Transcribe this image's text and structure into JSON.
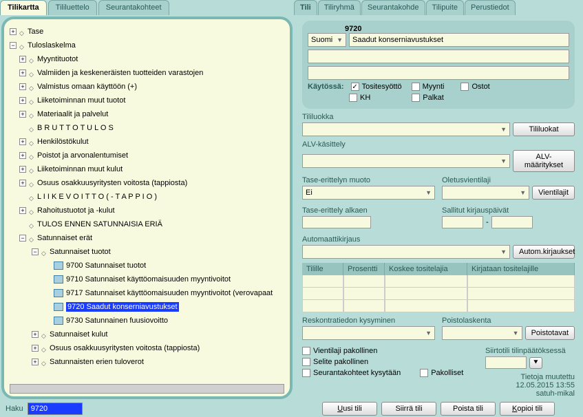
{
  "left_tabs": {
    "t1": "Tilikartta",
    "t2": "Tililuettelo",
    "t3": "Seurantakohteet"
  },
  "right_tabs": {
    "t1": "Tili",
    "t2": "Tiliryhmä",
    "t3": "Seurantakohde",
    "t4": "Tilipuite",
    "t5": "Perustiedot"
  },
  "tree": {
    "tase": "Tase",
    "tulos": "Tuloslaskelma",
    "myyntituotot": "Myyntituotot",
    "valmiiden": "Valmiiden ja keskeneräisten tuotteiden varastojen",
    "valmistus": "Valmistus omaan käyttöön (+)",
    "liiketoim_tuotot": "Liiketoiminnan muut tuotot",
    "materiaalit": "Materiaalit ja palvelut",
    "bruttotulos": "B R U T T O T U L O S",
    "henkilosto": "Henkilöstökulut",
    "poistot": "Poistot ja arvonalentumiset",
    "liiketoim_kulut": "Liiketoiminnan muut kulut",
    "osuus_voitosta": "Osuus osakkuusyritysten voitosta (tappiosta)",
    "liikevoitto": "L I I K E V O I T T O  ( - T A P P I O )",
    "rahoitus": "Rahoitustuotot ja -kulut",
    "tulos_ennen": "TULOS ENNEN SATUNNAISIA ERIÄ",
    "satunnaiset": "Satunnaiset erät",
    "sat_tuotot": "Satunnaiset tuotot",
    "a9700": "9700 Satunnaiset tuotot",
    "a9710": "9710 Satunnaiset käyttöomaisuuden myyntivoitot",
    "a9717": "9717 Satunnaiset käyttöomaisuuden myyntivoitot (verovapaat",
    "a9720": "9720 Saadut konserniavustukset",
    "a9730": "9730 Satunnainen fuusiovoitto",
    "sat_kulut": "Satunnaiset kulut",
    "osuus_voitosta2": "Osuus osakkuusyritysten voitosta (tappiosta)",
    "sat_tuloverot": "Satunnaisten erien tuloverot"
  },
  "search": {
    "label": "Haku",
    "value": "9720"
  },
  "account": {
    "number": "9720",
    "lang": "Suomi",
    "name": "Saadut konserniavustukset",
    "kaytossa_label": "Käytössä:",
    "chk_tosite": "Tositesyöttö",
    "chk_myynti": "Myynti",
    "chk_ostot": "Ostot",
    "chk_kh": "KH",
    "chk_palkat": "Palkat",
    "tililuokka_label": "Tililuokka",
    "btn_tililuokat": "Tililuokat",
    "alv_label": "ALV-käsittely",
    "btn_alv": "ALV-määritykset",
    "tase_erittely_label": "Tase-erittelyn muoto",
    "tase_erittely_val": "Ei",
    "oletusvienti_label": "Oletusvientilaji",
    "btn_vientilajit": "Vientilajit",
    "tase_alkaen_label": "Tase-erittely alkaen",
    "sallitut_label": "Sallitut kirjauspäivät",
    "autokirjaus_label": "Automaattikirjaus",
    "btn_autokirjaus": "Autom.kirjaukset",
    "grid_tilille": "Tilille",
    "grid_prosentti": "Prosentti",
    "grid_koskee": "Koskee tositelajia",
    "grid_kirjataan": "Kirjataan tositelajille",
    "reskontra_label": "Reskontratiedon kysyminen",
    "poistolask_label": "Poistolaskenta",
    "btn_poistotavat": "Poistotavat",
    "vientilaji_pak": "Vientilaji pakollinen",
    "siirtotili_label": "Siirtotili tilinpäätöksessä",
    "selite_pak": "Selite pakollinen",
    "seuranta_kys": "Seurantakohteet kysytään",
    "pakolliset": "Pakolliset",
    "meta1": "Tietoja muutettu",
    "meta2": "12.05.2015 13:55",
    "meta3": "satuh-mikal",
    "btn_uusi": "Uusi tili",
    "btn_siirra": "Siirrä tili",
    "btn_poista": "Poista tili",
    "btn_kopioi": "Kopioi tili"
  }
}
